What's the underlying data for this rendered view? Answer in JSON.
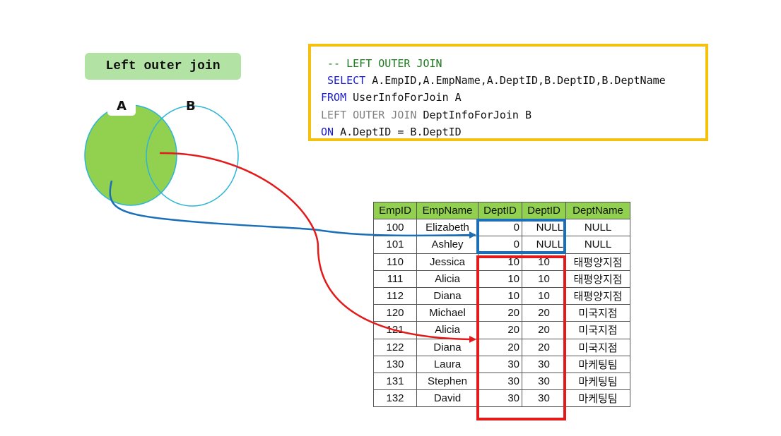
{
  "badge": {
    "title": "Left outer join"
  },
  "venn": {
    "set_a": "A",
    "set_b": "B"
  },
  "sql": {
    "line1": "-- LEFT OUTER JOIN",
    "line2_kw": "SELECT",
    "line2_rest": " A.EmpID,A.EmpName,A.DeptID,B.DeptID,B.DeptName",
    "line3_kw": "FROM",
    "line3_rest": " UserInfoForJoin A",
    "line4_kw": "LEFT OUTER JOIN",
    "line4_rest": " DeptInfoForJoin B",
    "line5_kw": "ON",
    "line5_rest": " A.DeptID = B.DeptID"
  },
  "table": {
    "headers": [
      "EmpID",
      "EmpName",
      "DeptID",
      "DeptID",
      "DeptName"
    ],
    "rows": [
      [
        "100",
        "Elizabeth",
        "0",
        "NULL",
        "NULL"
      ],
      [
        "101",
        "Ashley",
        "0",
        "NULL",
        "NULL"
      ],
      [
        "110",
        "Jessica",
        "10",
        "10",
        "태평양지점"
      ],
      [
        "111",
        "Alicia",
        "10",
        "10",
        "태평양지점"
      ],
      [
        "112",
        "Diana",
        "10",
        "10",
        "태평양지점"
      ],
      [
        "120",
        "Michael",
        "20",
        "20",
        "미국지점"
      ],
      [
        "121",
        "Alicia",
        "20",
        "20",
        "미국지점"
      ],
      [
        "122",
        "Diana",
        "20",
        "20",
        "미국지점"
      ],
      [
        "130",
        "Laura",
        "30",
        "30",
        "마케팅팀"
      ],
      [
        "131",
        "Stephen",
        "30",
        "30",
        "마케팅팀"
      ],
      [
        "132",
        "David",
        "30",
        "30",
        "마케팅팀"
      ]
    ]
  },
  "colors": {
    "set_a_fill": "#92d050",
    "circle_stroke": "#2bb5d8",
    "blue_highlight": "#1a6fb8",
    "red_highlight": "#e31a1a",
    "sql_border": "#f4c10f"
  }
}
